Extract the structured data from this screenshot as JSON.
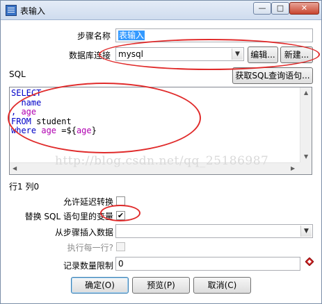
{
  "window": {
    "title": "表输入",
    "controls": {
      "minimize": "—",
      "maximize": "□",
      "close": "✕"
    }
  },
  "form": {
    "step_name_label": "步骤名称",
    "step_name_value": "表输入",
    "db_connection_label": "数据库连接",
    "db_connection_value": "mysql",
    "edit_button": "编辑...",
    "new_button": "新建...",
    "sql_label": "SQL",
    "get_sql_button": "获取SQL查询语句..."
  },
  "sql_editor": {
    "lines": [
      [
        {
          "t": "SELECT",
          "c": "kw"
        }
      ],
      [
        {
          "t": "  name",
          "c": "kw"
        }
      ],
      [
        {
          "t": ", ",
          "c": "kw"
        },
        {
          "t": "age",
          "c": "var"
        }
      ],
      [
        {
          "t": "FROM",
          "c": "kw"
        },
        {
          "t": " student",
          "c": "pl"
        }
      ],
      [
        {
          "t": "where",
          "c": "kw"
        },
        {
          "t": " ",
          "c": "pl"
        },
        {
          "t": "age",
          "c": "var"
        },
        {
          "t": " =${",
          "c": "pl"
        },
        {
          "t": "age",
          "c": "var"
        },
        {
          "t": "}",
          "c": "pl"
        }
      ]
    ],
    "watermark": "http://blog.csdn.net/qq_25186987"
  },
  "status": {
    "position": "行1 列0"
  },
  "options": {
    "lazy_conversion_label": "允许延迟转换",
    "lazy_conversion_checked": false,
    "replace_variables_label": "替换 SQL 语句里的变量",
    "replace_variables_checked": true,
    "insert_from_step_label": "从步骤插入数据",
    "insert_from_step_value": "",
    "execute_each_row_label": "执行每一行?",
    "execute_each_row_checked": false,
    "limit_label": "记录数量限制",
    "limit_value": "0"
  },
  "buttons": {
    "ok": "确定(O)",
    "preview": "预览(P)",
    "cancel": "取消(C)"
  },
  "colors": {
    "annotation": "#e02b2b",
    "keyword": "#0000c8",
    "variable": "#b000b0"
  }
}
